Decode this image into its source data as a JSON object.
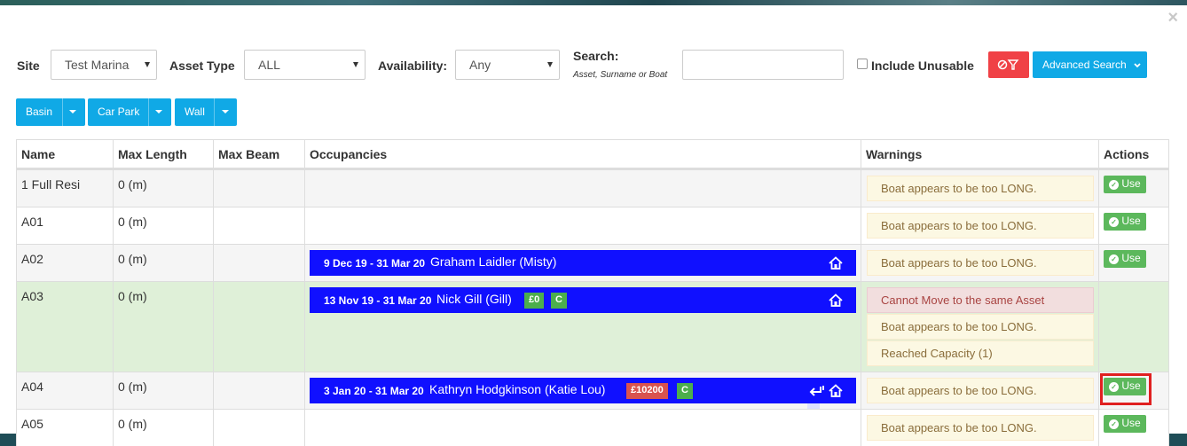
{
  "filters": {
    "site_label": "Site",
    "site_value": "Test Marina",
    "asset_type_label": "Asset Type",
    "asset_type_value": "ALL",
    "availability_label": "Availability:",
    "availability_value": "Any",
    "search_label": "Search:",
    "search_hint": "Asset, Surname or Boat",
    "search_value": "",
    "include_unusable_label": "Include Unusable",
    "include_unusable_checked": false,
    "advanced_search_label": "Advanced Search"
  },
  "groups": [
    {
      "label": "Basin"
    },
    {
      "label": "Car Park"
    },
    {
      "label": "Wall"
    }
  ],
  "table": {
    "headers": [
      "Name",
      "Max Length",
      "Max Beam",
      "Occupancies",
      "Warnings",
      "Actions"
    ],
    "use_label": "Use",
    "rows": [
      {
        "name": "1 Full Resi",
        "max_length": "0 (m)",
        "max_beam": "",
        "warnings": [
          "Boat appears to be too LONG."
        ]
      },
      {
        "name": "A01",
        "max_length": "0 (m)",
        "max_beam": "",
        "warnings": [
          "Boat appears to be too LONG."
        ]
      },
      {
        "name": "A02",
        "max_length": "0 (m)",
        "max_beam": "",
        "occupancy": {
          "dates": "9 Dec 19 - 31 Mar 20",
          "name": "Graham Laidler (Misty)"
        },
        "warnings": [
          "Boat appears to be too LONG."
        ]
      },
      {
        "name": "A03",
        "max_length": "0 (m)",
        "max_beam": "",
        "occupancy": {
          "dates": "13 Nov 19 - 31 Mar 20",
          "name": "Nick Gill (Gill)",
          "badge_amount": "£0",
          "badge_c": "C"
        },
        "warnings": [
          "Cannot Move to the same Asset",
          "Boat appears to be too LONG.",
          "Reached Capacity (1)"
        ]
      },
      {
        "name": "A04",
        "max_length": "0 (m)",
        "max_beam": "",
        "occupancy": {
          "dates": "3 Jan 20 - 31 Mar 20",
          "name": "Kathryn Hodgkinson (Katie Lou)",
          "badge_amount": "£10200",
          "badge_c": "C"
        },
        "warnings": [
          "Boat appears to be too LONG."
        ]
      },
      {
        "name": "A05",
        "max_length": "0 (m)",
        "max_beam": "",
        "warnings": [
          "Boat appears to be too LONG."
        ]
      }
    ]
  },
  "colors": {
    "occupancy_bar": "#1010ff",
    "selected_row": "#dff0d8",
    "use_button": "#5cb85c",
    "highlight": "#e02020",
    "filter_clear": "#f04146",
    "primary": "#10a9e6"
  }
}
